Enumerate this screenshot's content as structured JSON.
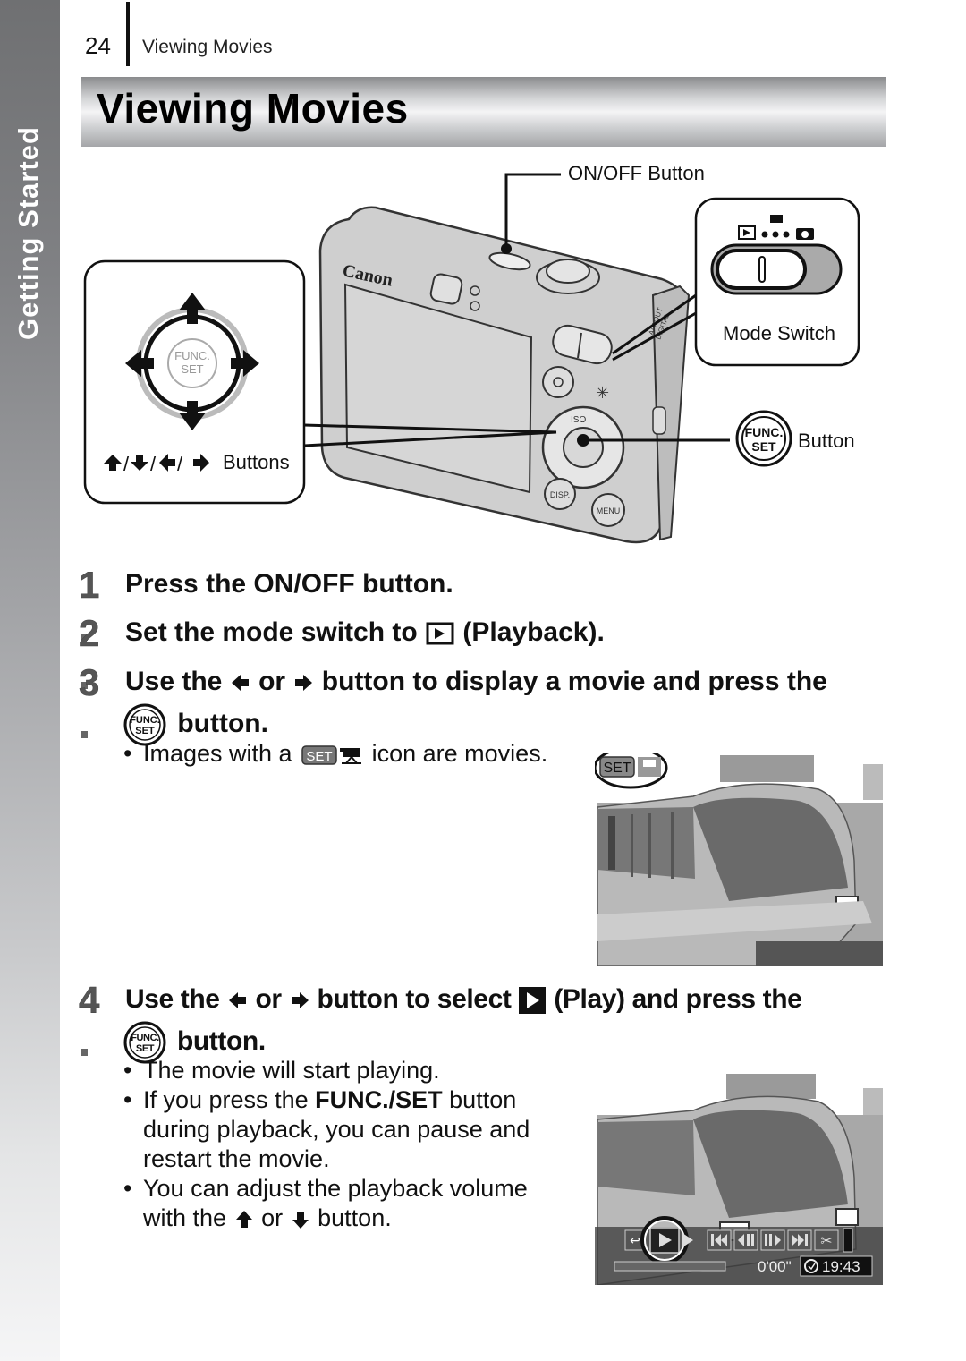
{
  "side_tab": {
    "label": "Getting Started"
  },
  "running_header": {
    "page_number": "24",
    "section": "Viewing Movies"
  },
  "title": "Viewing Movies",
  "illustration": {
    "callouts": {
      "on_off": "ON/OFF Button",
      "mode_switch": "Mode Switch",
      "func_set": "Button",
      "arrows": "Buttons"
    },
    "camera": {
      "brand": "Canon",
      "func_label_1": "FUNC.",
      "func_label_2": "SET",
      "disp_label": "DISP.",
      "menu_label": "MENU",
      "iso_label": "ISO",
      "av_label_1": "A/V OUT",
      "av_label_2": "DIGITAL"
    }
  },
  "steps": [
    {
      "number": "1",
      "text": "Press the ON/OFF button."
    },
    {
      "number": "2",
      "text_before": "Set the mode switch to",
      "text_after": "(Playback)."
    },
    {
      "number": "3",
      "text_part1": "Use the",
      "text_part2": "or",
      "text_part3": "button to display a movie and press the",
      "text_line2": "button.",
      "bullets": [
        {
          "before": "Images with a",
          "after": "icon are movies."
        }
      ]
    },
    {
      "number": "4",
      "text_part1": "Use the",
      "text_part2": "or",
      "text_part3": "button to select",
      "text_part4": "(Play) and press the",
      "text_line2": "button.",
      "bullets": [
        {
          "text": "The movie will start playing."
        },
        {
          "before": "If you press the",
          "bold": "FUNC./SET",
          "after": "button during playback, you can pause and restart the movie."
        },
        {
          "before": "You can adjust the playback volume with the",
          "mid": "or",
          "after": "button."
        }
      ]
    }
  ],
  "screens": {
    "movie_icon_label": "SET",
    "playback": {
      "elapsed": "0'00\"",
      "clock": "19:43",
      "progress": 0.0
    }
  },
  "icons": {
    "func_set_small_1": "FUNC.",
    "func_set_small_2": "SET"
  }
}
